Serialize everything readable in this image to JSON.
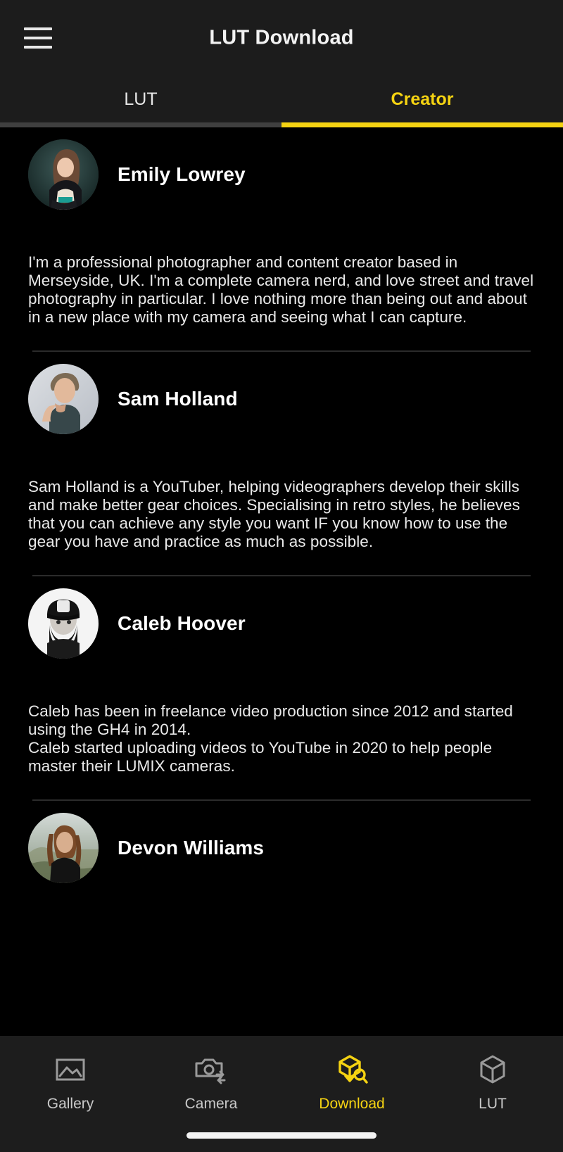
{
  "app": {
    "title": "LUT Download",
    "menu_icon": "hamburger-menu-icon",
    "accent_color": "#f5d312",
    "background_color": "#000000",
    "appbar_color": "#1c1c1c"
  },
  "tabs": [
    {
      "label": "LUT",
      "active": false
    },
    {
      "label": "Creator",
      "active": true
    }
  ],
  "creators": [
    {
      "name": "Emily Lowrey",
      "bio": "I'm a professional photographer and content creator based in Merseyside, UK. I'm a complete camera nerd, and love street and travel photography in particular. I love nothing more than being out and about in a new place with my camera and seeing what I can capture.",
      "avatar": "avatar-emily-lowrey"
    },
    {
      "name": "Sam Holland",
      "bio": "Sam Holland is a YouTuber, helping videographers develop their skills and make better gear choices. Specialising in retro styles, he believes that you can achieve any style you want IF you know how to use the gear you have and practice as much as possible.",
      "avatar": "avatar-sam-holland"
    },
    {
      "name": "Caleb Hoover",
      "bio": "Caleb has been in freelance video production since 2012 and started using the GH4 in 2014.\nCaleb started uploading videos to YouTube in 2020 to help people master their LUMIX cameras.",
      "avatar": "avatar-caleb-hoover"
    },
    {
      "name": "Devon Williams",
      "bio": "",
      "avatar": "avatar-devon-williams"
    }
  ],
  "bottom_nav": [
    {
      "label": "Gallery",
      "icon": "gallery-icon",
      "active": false
    },
    {
      "label": "Camera",
      "icon": "camera-transfer-icon",
      "active": false
    },
    {
      "label": "Download",
      "icon": "cube-download-search-icon",
      "active": true
    },
    {
      "label": "LUT",
      "icon": "cube-icon",
      "active": false
    }
  ]
}
